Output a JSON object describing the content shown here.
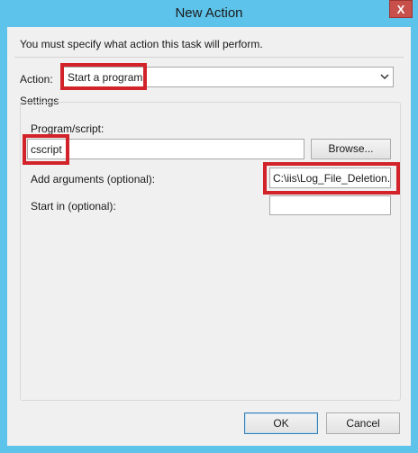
{
  "window": {
    "title": "New Action",
    "close_glyph": "X"
  },
  "instruction": "You must specify what action this task will perform.",
  "action": {
    "label": "Action:",
    "selected": "Start a program"
  },
  "settings": {
    "group_label": "Settings",
    "program_label": "Program/script:",
    "program_value": "cscript",
    "browse_label": "Browse...",
    "arguments_label": "Add arguments (optional):",
    "arguments_value": "C:\\iis\\Log_File_Deletion.v",
    "start_in_label": "Start in (optional):",
    "start_in_value": ""
  },
  "footer": {
    "ok_label": "OK",
    "cancel_label": "Cancel"
  },
  "colors": {
    "frame": "#5ec3ea",
    "close": "#c7504b",
    "highlight": "#d2232a"
  }
}
